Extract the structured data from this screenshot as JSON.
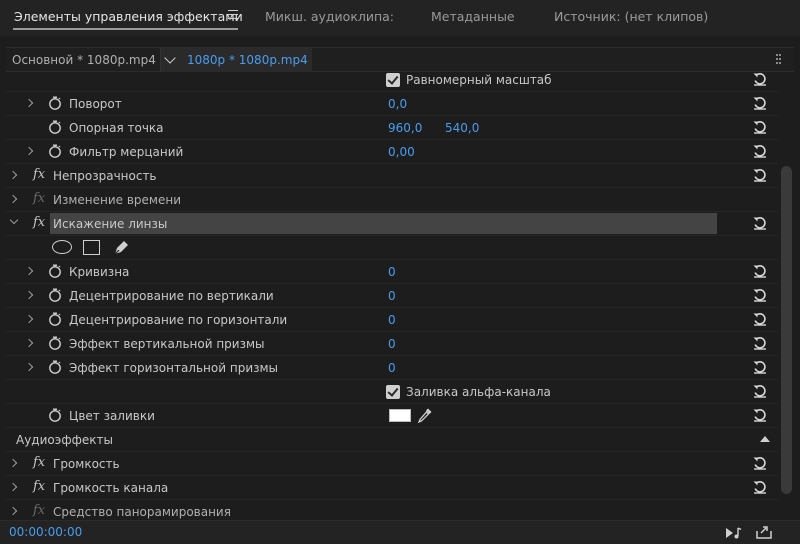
{
  "tabs": {
    "effect_controls": "Элементы управления эффектами",
    "audio_clip_mixer": "Микш. аудиоклипа:",
    "metadata": "Метаданные",
    "source": "Источник: (нет клипов)"
  },
  "clip_tabs": {
    "master": "Основной * 1080p.mp4",
    "sequence": "1080p * 1080p.mp4"
  },
  "rows": {
    "uniform_scale": "Равномерный масштаб",
    "rotation": {
      "label": "Поворот",
      "value": "0,0"
    },
    "anchor_point": {
      "label": "Опорная точка",
      "x": "960,0",
      "y": "540,0"
    },
    "anti_flicker": {
      "label": "Фильтр мерцаний",
      "value": "0,00"
    },
    "opacity": "Непрозрачность",
    "time_remapping": "Изменение времени",
    "lens_distortion": "Искажение линзы",
    "curvature": {
      "label": "Кривизна",
      "value": "0"
    },
    "vertical_decentering": {
      "label": "Децентрирование по вертикали",
      "value": "0"
    },
    "horizontal_decentering": {
      "label": "Децентрирование по горизонтали",
      "value": "0"
    },
    "vertical_prism_fx": {
      "label": "Эффект вертикальной призмы",
      "value": "0"
    },
    "horizontal_prism_fx": {
      "label": "Эффект горизонтальной призмы",
      "value": "0"
    },
    "fill_alpha": "Заливка альфа-канала",
    "fill_color": "Цвет заливки"
  },
  "audio": {
    "section_title": "Аудиоэффекты",
    "volume": "Громкость",
    "channel_volume": "Громкость канала",
    "panner": "Средство панорамирования"
  },
  "footer": {
    "timecode": "00:00:00:00"
  },
  "colors": {
    "accent_blue": "#4a9cf0",
    "panel_bg": "#1d1d1d",
    "highlight_row": "#444444",
    "fill_color_swatch": "#ffffff"
  },
  "icons": {
    "stopwatch": "stopwatch-icon",
    "reset": "reset-icon",
    "fx": "fx-icon",
    "eyedropper": "eyedropper-icon",
    "pen": "pen-mask-icon"
  }
}
